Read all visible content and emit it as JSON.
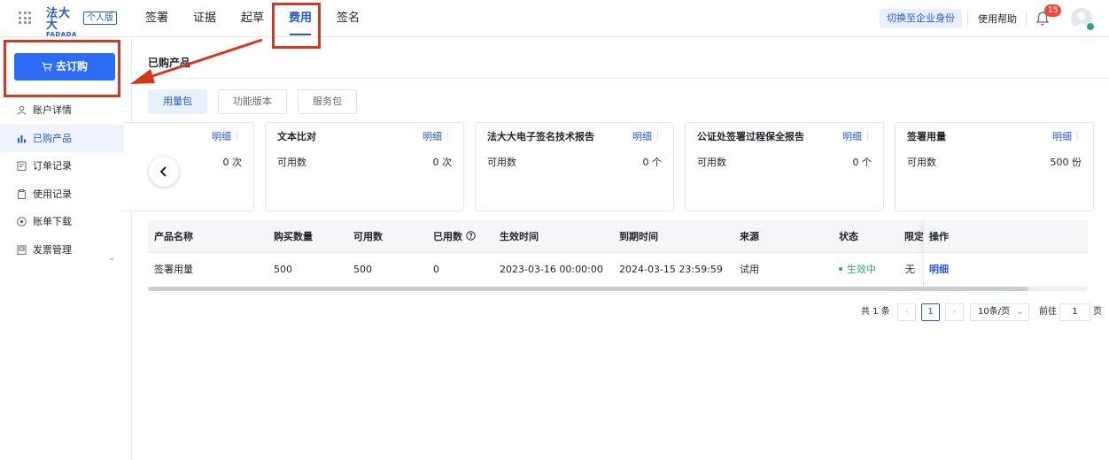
{
  "topbar": {
    "logo_cn": "法大大",
    "logo_en": "FADADA",
    "edition": "个人版",
    "nav": [
      "签署",
      "证据",
      "起草",
      "费用",
      "签名"
    ],
    "active_nav": "费用",
    "switch_identity": "切换至企业身份",
    "help": "使用帮助",
    "notification_count": "15"
  },
  "sidebar": {
    "order_button": "去订购",
    "items": [
      {
        "label": "账户详情",
        "icon": "user-icon"
      },
      {
        "label": "已购产品",
        "icon": "bar-chart-icon"
      },
      {
        "label": "订单记录",
        "icon": "order-icon"
      },
      {
        "label": "使用记录",
        "icon": "clipboard-icon"
      },
      {
        "label": "账单下载",
        "icon": "download-icon"
      },
      {
        "label": "发票管理",
        "icon": "invoice-icon"
      }
    ],
    "active_item": "已购产品"
  },
  "main": {
    "title": "已购产品",
    "tabs": [
      "用量包",
      "功能版本",
      "服务包"
    ],
    "active_tab": "用量包",
    "cards": [
      {
        "title": "",
        "detail": "明细",
        "key": "",
        "value": "0 次"
      },
      {
        "title": "文本比对",
        "detail": "明细",
        "key": "可用数",
        "value": "0 次"
      },
      {
        "title": "法大大电子签名技术报告",
        "detail": "明细",
        "key": "可用数",
        "value": "0 个"
      },
      {
        "title": "公证处签署过程保全报告",
        "detail": "明细",
        "key": "可用数",
        "value": "0 个"
      },
      {
        "title": "签署用量",
        "detail": "明细",
        "key": "可用数",
        "value": "500 份"
      }
    ],
    "table": {
      "headers": [
        "产品名称",
        "购买数量",
        "可用数",
        "已用数",
        "生效时间",
        "到期时间",
        "来源",
        "状态",
        "限定",
        "操作"
      ],
      "rows": [
        [
          "签署用量",
          "500",
          "500",
          "0",
          "2023-03-16 00:00:00",
          "2024-03-15 23:59:59",
          "试用",
          "生效中",
          "无",
          "明细"
        ]
      ]
    },
    "pagination": {
      "total": "共 1 条",
      "current_page": "1",
      "page_size": "10条/页",
      "goto_prefix": "前往",
      "goto_value": "1",
      "goto_suffix": "页"
    }
  },
  "colors": {
    "brand": "#2557d6",
    "button": "#2d6cf5",
    "annotation": "#d6361f",
    "status_active": "#28a86b"
  }
}
